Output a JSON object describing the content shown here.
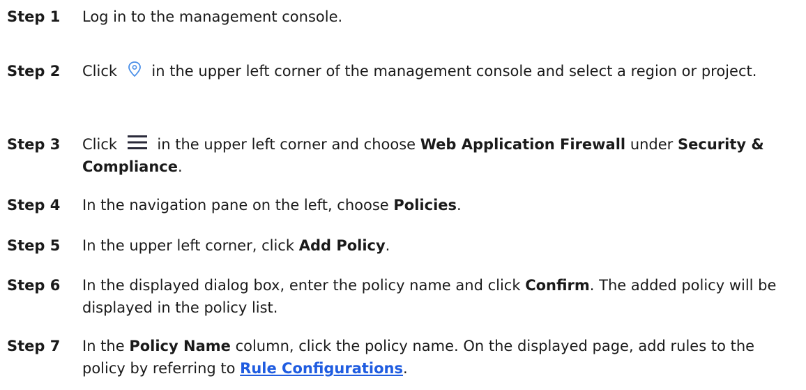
{
  "steps": [
    {
      "label": "Step 1",
      "text": "Log in to the management console."
    },
    {
      "label": "Step 2",
      "pre": "Click",
      "icon": "location-pin-icon",
      "post": "in the upper left corner of the management console and select a region or project."
    },
    {
      "label": "Step 3",
      "pre": "Click",
      "icon": "hamburger-menu-icon",
      "mid": "in the upper left corner and choose",
      "bold1": "Web Application Firewall",
      "mid2": "under",
      "bold2": "Security & Compliance",
      "end": "."
    },
    {
      "label": "Step 4",
      "pre": "In the navigation pane on the left, choose",
      "bold": "Policies",
      "end": "."
    },
    {
      "label": "Step 5",
      "pre": "In the upper left corner, click",
      "bold": "Add Policy",
      "end": "."
    },
    {
      "label": "Step 6",
      "pre": "In the displayed dialog box, enter the policy name and click",
      "bold": "Confirm",
      "post": ". The added policy will be displayed in the policy list."
    },
    {
      "label": "Step 7",
      "pre": "In the",
      "bold": "Policy Name",
      "mid": "column, click the policy name. On the displayed page, add rules to the policy by referring to",
      "link": "Rule Configurations",
      "end": "."
    }
  ],
  "colors": {
    "text": "#1a1a1a",
    "link": "#1f5ce0",
    "pin_icon": "#3b82f6"
  }
}
